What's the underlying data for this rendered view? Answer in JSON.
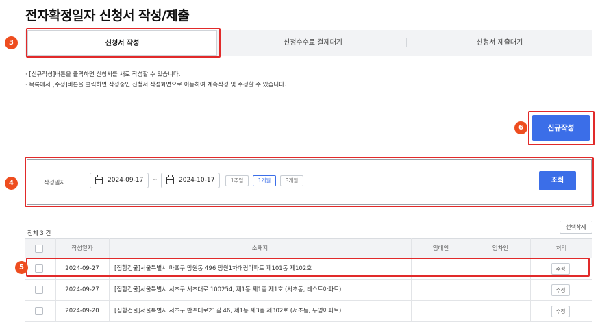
{
  "page": {
    "title": "전자확정일자 신청서 작성/제출"
  },
  "tabs": [
    {
      "label": "신청서 작성",
      "active": true
    },
    {
      "label": "신청수수료 결제대기",
      "active": false
    },
    {
      "label": "신청서 제출대기",
      "active": false
    }
  ],
  "markers": {
    "tabs": "3",
    "filter": "4",
    "row": "5",
    "new": "6"
  },
  "notes": [
    "· [신규작성]버튼을 클릭하면 신청서를 새로 작성할 수 있습니다.",
    "· 목록에서 [수정]버튼을 클릭하면 작성중인 신청서 작성화면으로 이동하여 계속작성 및 수정할 수 있습니다."
  ],
  "new_button": {
    "label": "신규작성"
  },
  "filter": {
    "label": "작성일자",
    "date_from": "2024-09-17",
    "date_to": "2024-10-17",
    "dash": "~",
    "periods": [
      {
        "label": "1주일",
        "selected": false
      },
      {
        "label": "1개월",
        "selected": true
      },
      {
        "label": "3개월",
        "selected": false
      }
    ],
    "search_label": "조회"
  },
  "list": {
    "total_text": "전체  3  건",
    "delete_label": "선택삭제"
  },
  "table": {
    "headers": {
      "date": "작성일자",
      "address": "소재지",
      "lessor": "임대인",
      "lessee": "임차인",
      "action": "처리"
    },
    "rows": [
      {
        "date": "2024-09-27",
        "address": "[집합건물]서울특별시 마포구 망원동 496 망원1차대림아파트 제101동 제102호",
        "lessor": "",
        "lessee": "",
        "action": "수정"
      },
      {
        "date": "2024-09-27",
        "address": "[집합건물]서울특별시 서초구 서초대로 100254, 제1동 제1층 제1호 (서초동, 테스트아파트)",
        "lessor": "",
        "lessee": "",
        "action": "수정"
      },
      {
        "date": "2024-09-20",
        "address": "[집합건물]서울특별시 서초구 반포대로21길 46, 제1동 제3층 제302호 (서초동, 두영아파트)",
        "lessor": "",
        "lessee": "",
        "action": "수정"
      }
    ]
  },
  "colors": {
    "accent": "#3b6ee8",
    "highlight": "#e12a2a",
    "marker": "#ee4d1f"
  }
}
